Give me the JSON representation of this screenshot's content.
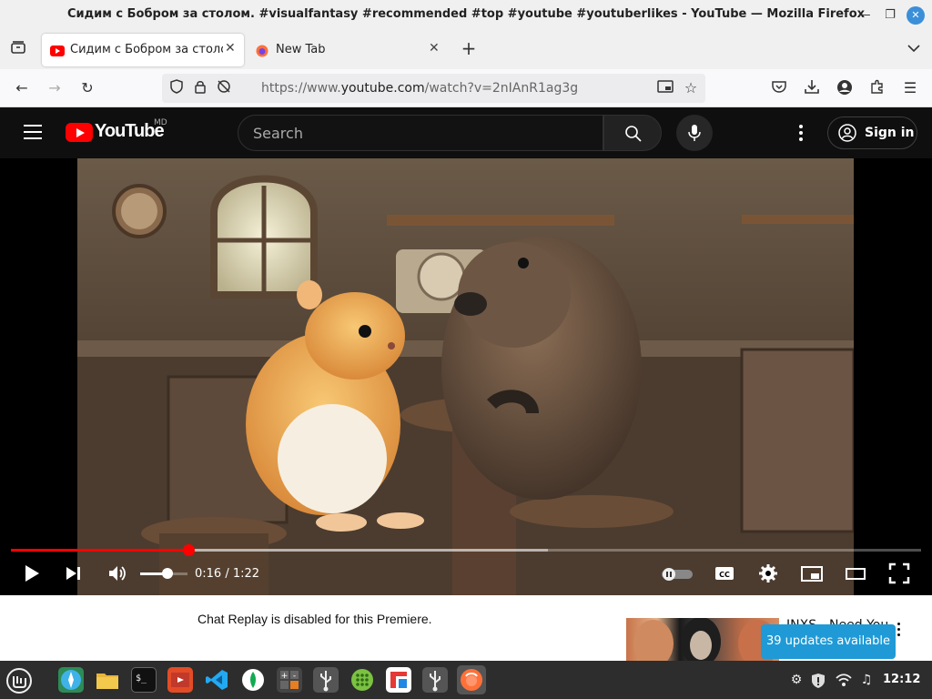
{
  "window": {
    "title": "Сидим с Бобром за столом. #visualfantasy #recommended #top #youtube #youtuberlikes - YouTube — Mozilla Firefox"
  },
  "tabs": [
    {
      "label": "Сидим с Бобром за столом. #",
      "active": true,
      "icon": "youtube-icon"
    },
    {
      "label": "New Tab",
      "active": false,
      "icon": "firefox-icon"
    }
  ],
  "navbar": {
    "url_prefix": "https://www.",
    "url_domain": "youtube.com",
    "url_path": "/watch?v=2nIAnR1ag3g"
  },
  "youtube": {
    "logo_text": "YouTube",
    "country_code": "MD",
    "search_placeholder": "Search",
    "sign_in_label": "Sign in",
    "accent": "#ff0000"
  },
  "player": {
    "progress": 0.195,
    "buffered": 0.59,
    "volume": 0.58,
    "time_current": "0:16",
    "time_total": "1:22"
  },
  "below": {
    "chat_message": "Chat Replay is disabled for this Premiere.",
    "recommendation_title": "INXS - Need You"
  },
  "notification": {
    "text": "39 updates available"
  },
  "taskbar": {
    "apps": [
      "mint-menu-icon",
      "web-browser-icon",
      "files-icon",
      "terminal-icon",
      "video-editor-icon",
      "vscode-icon",
      "mongodb-icon",
      "calculator-icon",
      "usb-icon",
      "app-grid-icon",
      "flameshot-icon",
      "usb-icon",
      "firefox-icon"
    ],
    "clock": "12:12"
  }
}
